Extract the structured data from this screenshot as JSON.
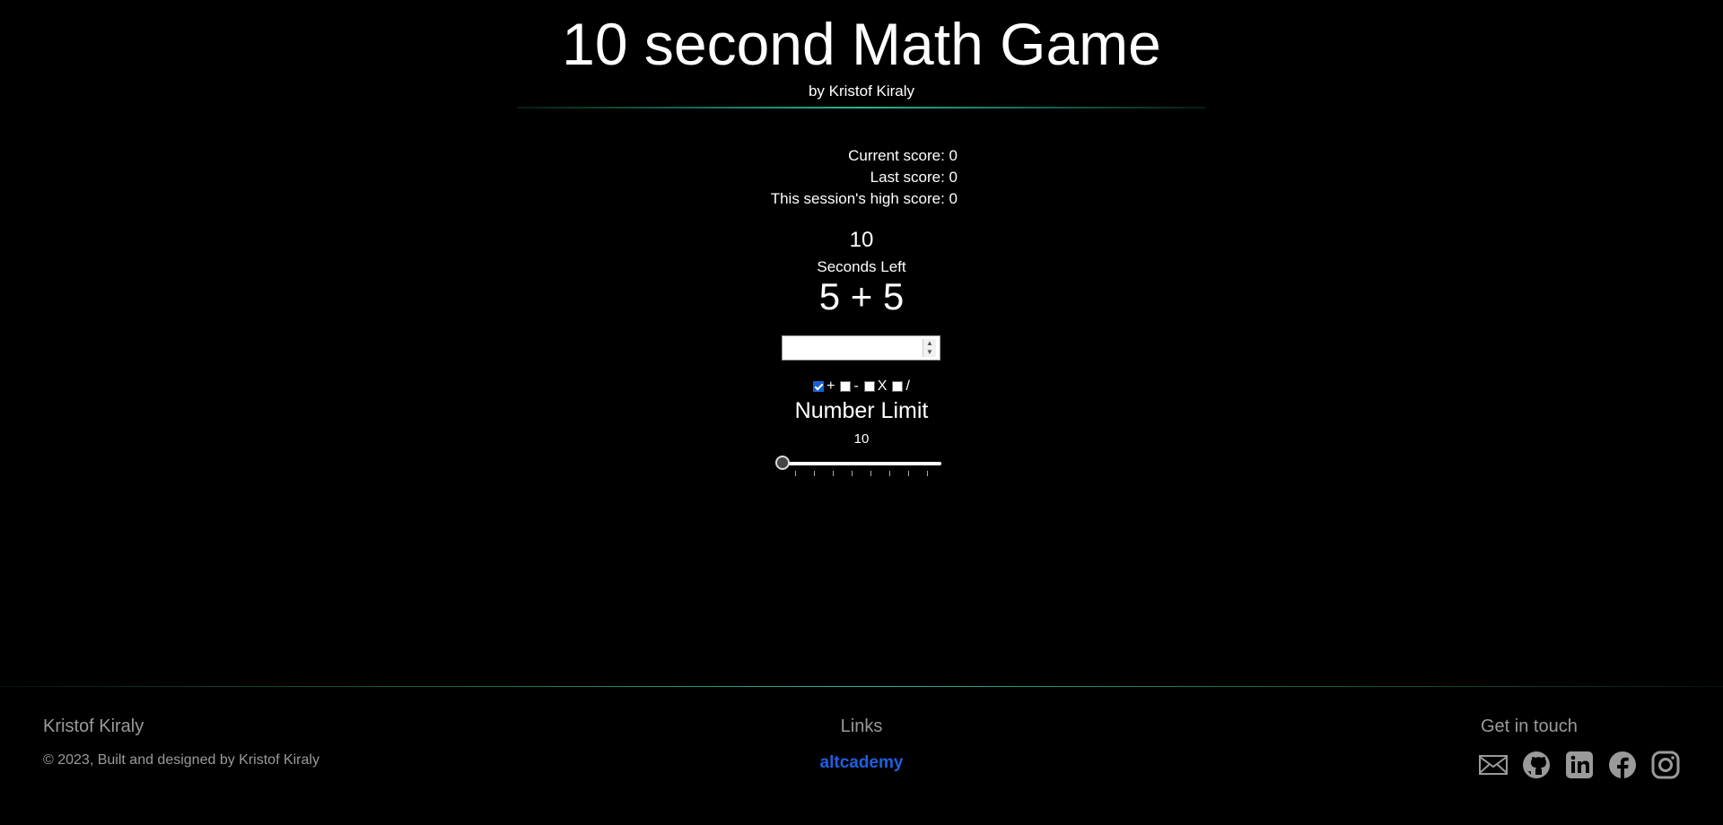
{
  "header": {
    "title": "10 second Math Game",
    "subtitle": "by Kristof Kiraly"
  },
  "scores": {
    "current": "Current score: 0",
    "last": "Last score: 0",
    "high": "This session's high score: 0"
  },
  "game": {
    "timer_value": "10",
    "timer_label": "Seconds Left",
    "problem": "5 + 5",
    "answer_value": ""
  },
  "operations": [
    {
      "label": "+",
      "checked": true
    },
    {
      "label": "-",
      "checked": false
    },
    {
      "label": "X",
      "checked": false
    },
    {
      "label": "/",
      "checked": false
    }
  ],
  "number_limit": {
    "title": "Number Limit",
    "value": "10",
    "slider_fraction": 0.0
  },
  "footer": {
    "name": "Kristof Kiraly",
    "copyright": "© 2023, Built and designed by Kristof Kiraly",
    "links_title": "Links",
    "links_link": "altcademy",
    "contact_title": "Get in touch",
    "social_icons": [
      "email-icon",
      "github-icon",
      "linkedin-icon",
      "facebook-icon",
      "instagram-icon"
    ]
  },
  "colors": {
    "accent_line": "#23b893",
    "link": "#1f5fe0",
    "muted_text": "#9a9a9a",
    "background": "#000000"
  }
}
